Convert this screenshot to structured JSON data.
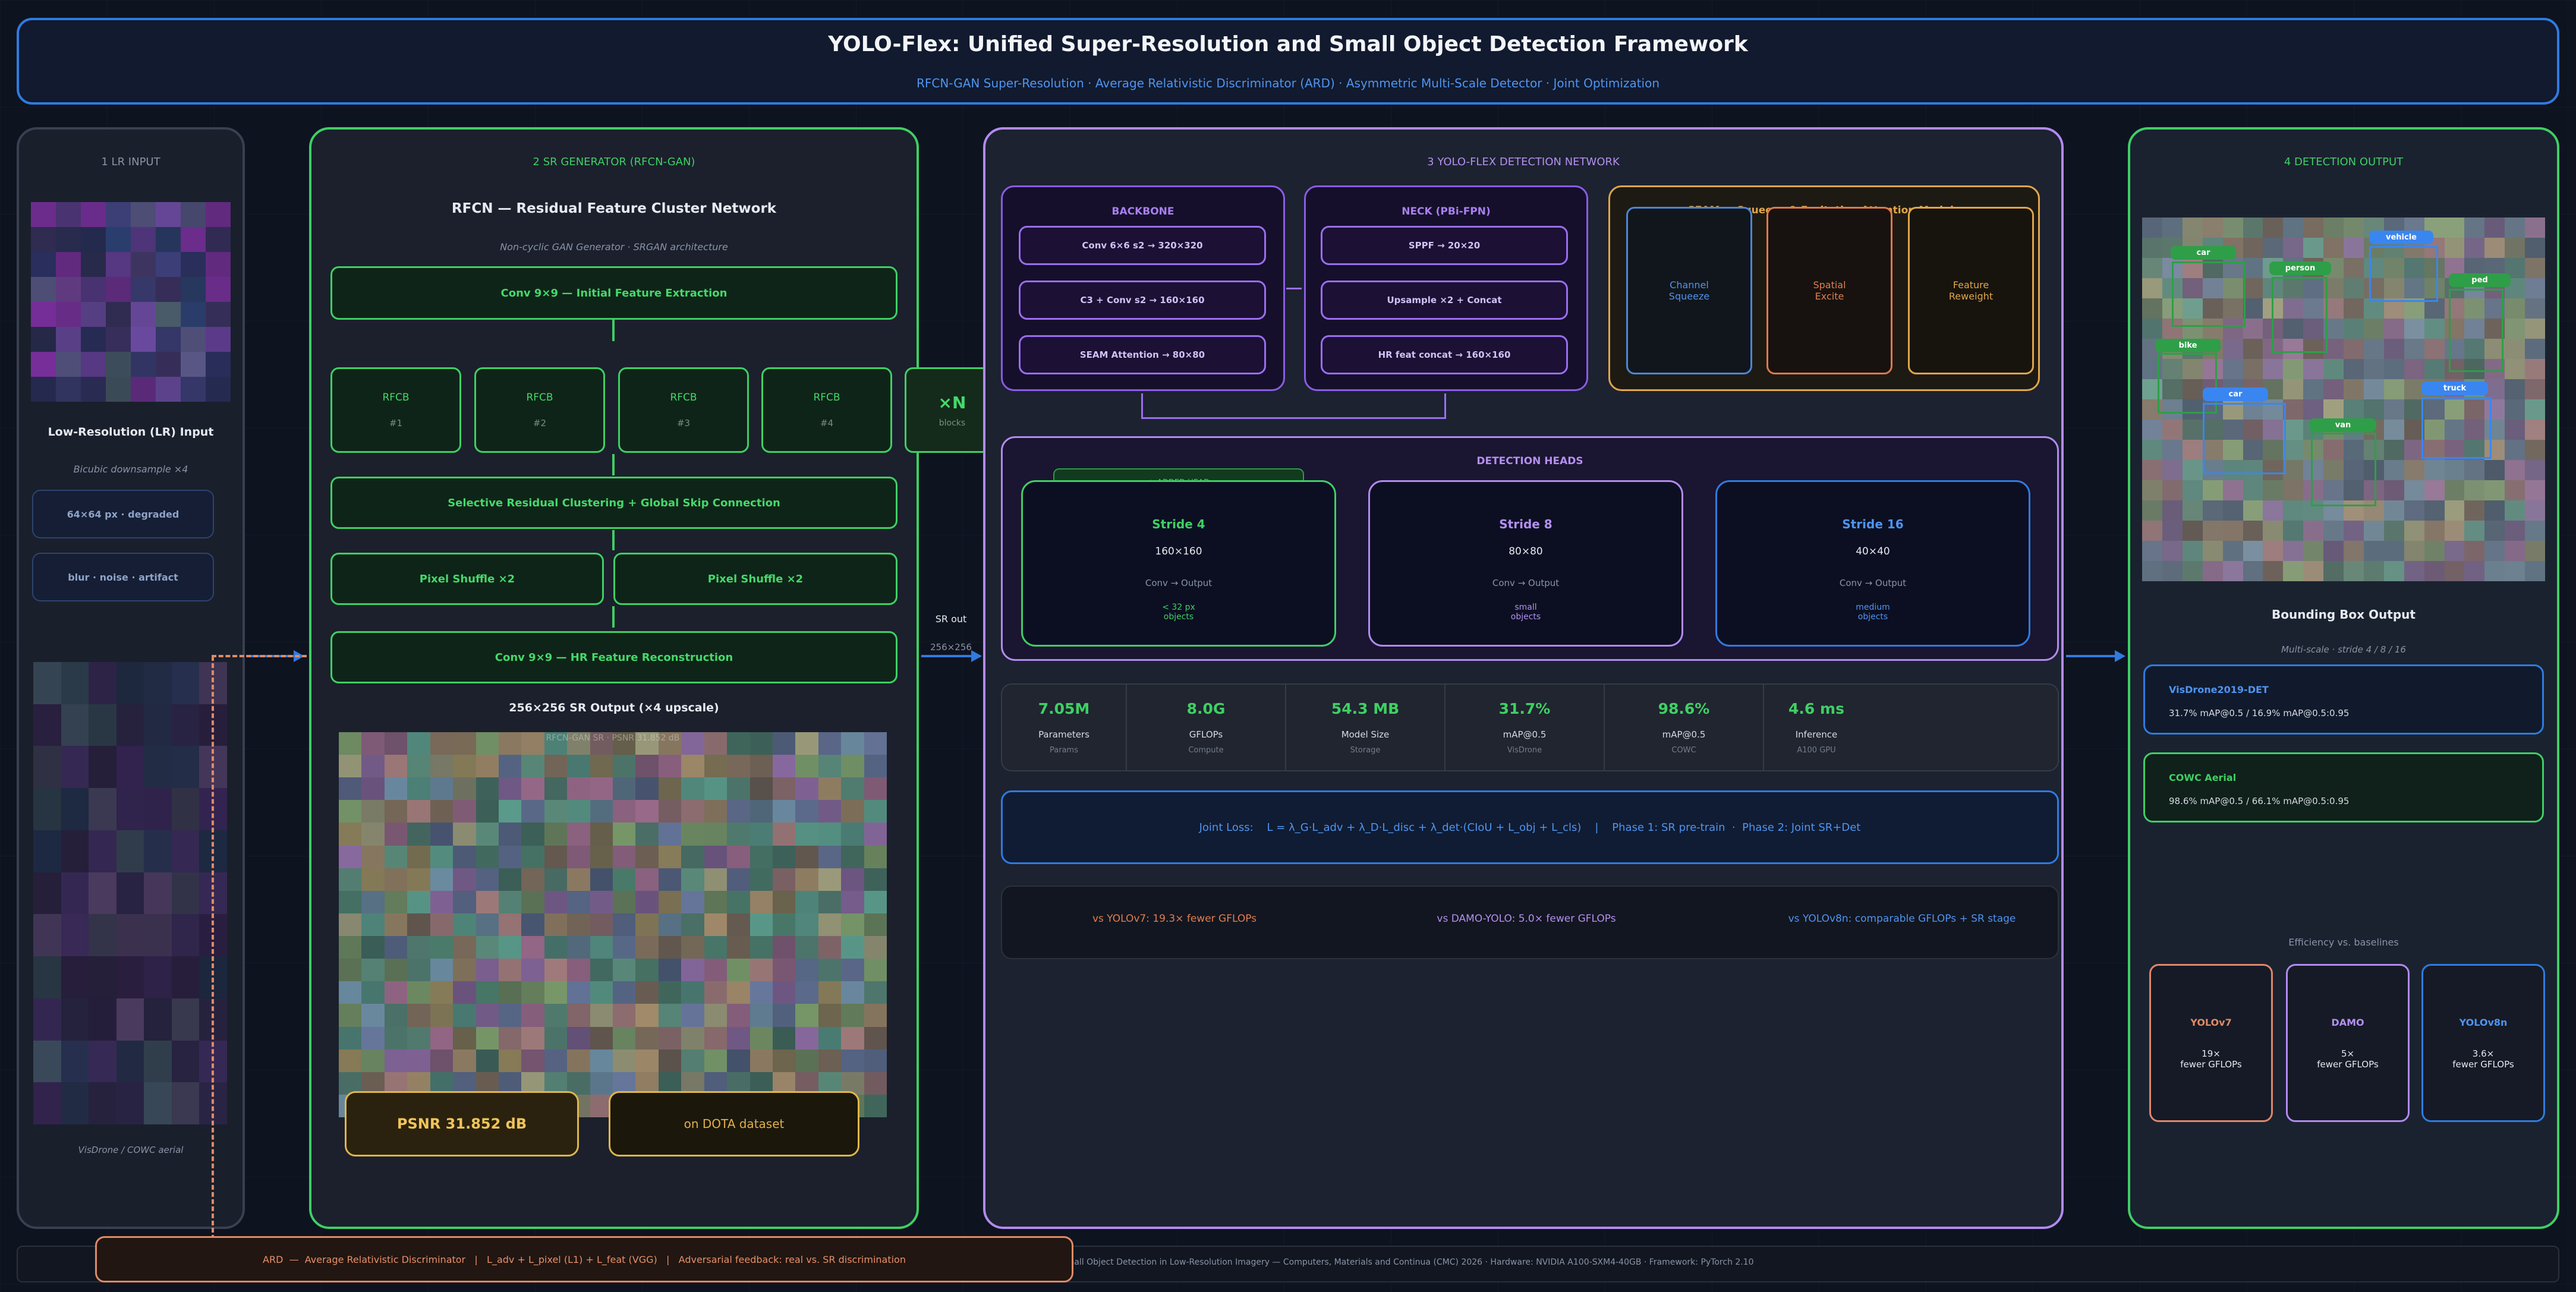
{
  "title": "YOLO-Flex: Unified Super-Resolution and Small Object Detection Framework",
  "subtitle": "RFCN-GAN Super-Resolution   ·   Average Relativistic Discriminator (ARD)   ·   Asymmetric Multi-Scale Detector   ·   Joint Optimization",
  "colors": {
    "green": "#3fcf64",
    "purple": "#9a6ef0",
    "blue": "#2f7be0",
    "orange": "#e0a64a",
    "salmon": "#e08a66"
  },
  "lr_input": {
    "header": "1  LR INPUT",
    "title": "Low-Resolution (LR) Input",
    "subtitle": "Bicubic downsample  ×4",
    "chip1": "64×64 px  ·  degraded",
    "chip2": "blur · noise · artifact",
    "caption": "VisDrone / COWC aerial"
  },
  "sr_generator": {
    "header": "2  SR GENERATOR (RFCN-GAN)",
    "title": "RFCN — Residual Feature Cluster Network",
    "subtitle": "Non-cyclic GAN Generator  ·  SRGAN architecture",
    "conv_in": "Conv 9×9  —  Initial Feature Extraction",
    "rfcb": [
      {
        "label": "RFCB",
        "num": "#1"
      },
      {
        "label": "RFCB",
        "num": "#2"
      },
      {
        "label": "RFCB",
        "num": "#3"
      },
      {
        "label": "RFCB",
        "num": "#4"
      }
    ],
    "repeat": "×N",
    "repeat_sub": "blocks",
    "clustering": "Selective Residual Clustering  +  Global Skip Connection",
    "pixel_shuffle_1": "Pixel Shuffle  ×2",
    "pixel_shuffle_2": "Pixel Shuffle  ×2",
    "conv_out": "Conv 9×9  —  HR Feature Reconstruction",
    "sr_output": "256×256 SR Output  (×4 upscale)",
    "sr_watermark": "RFCN-GAN SR  ·  PSNR 31.852 dB",
    "psnr": "PSNR  31.852 dB",
    "dataset": "on DOTA dataset",
    "sr_out_label": "SR out",
    "sr_out_size": "256×256"
  },
  "detection": {
    "header": "3  YOLO-FLEX DETECTION NETWORK",
    "backbone": {
      "title": "BACKBONE",
      "items": [
        "Conv 6×6 s2  →  320×320",
        "C3 + Conv s2  →  160×160",
        "SEAM Attention → 80×80"
      ]
    },
    "neck": {
      "title": "NECK  (PBi-FPN)",
      "items": [
        "SPPF  →  20×20",
        "Upsample ×2  +  Concat",
        "HR feat concat  →  160×160"
      ]
    },
    "seam": {
      "title": "SEAM  —  Squeeze & Excitation Attention Module",
      "steps": [
        {
          "line1": "Channel",
          "line2": "Squeeze"
        },
        {
          "line1": "Spatial",
          "line2": "Excite"
        },
        {
          "line1": "Feature",
          "line2": "Reweight"
        }
      ]
    },
    "heads": {
      "title": "DETECTION HEADS",
      "added": "★  ADDED HEAD",
      "items": [
        {
          "name": "Stride 4",
          "size": "160×160",
          "op": "Conv → Output",
          "target1": "< 32 px",
          "target2": "objects"
        },
        {
          "name": "Stride 8",
          "size": "80×80",
          "op": "Conv → Output",
          "target1": "small",
          "target2": "objects"
        },
        {
          "name": "Stride 16",
          "size": "40×40",
          "op": "Conv → Output",
          "target1": "medium",
          "target2": "objects"
        }
      ]
    },
    "metrics": [
      {
        "value": "7.05M",
        "label": "Parameters",
        "sub": "Params"
      },
      {
        "value": "8.0G",
        "label": "GFLOPs",
        "sub": "Compute"
      },
      {
        "value": "54.3 MB",
        "label": "Model Size",
        "sub": "Storage"
      },
      {
        "value": "31.7%",
        "label": "mAP@0.5",
        "sub": "VisDrone"
      },
      {
        "value": "98.6%",
        "label": "mAP@0.5",
        "sub": "COWC"
      },
      {
        "value": "4.6 ms",
        "label": "Inference",
        "sub": "A100 GPU"
      }
    ],
    "joint_loss": "Joint Loss:    L = λ_G·L_adv + λ_D·L_disc + λ_det·(CIoU + L_obj + L_cls)    |    Phase 1: SR pre-train  ·  Phase 2: Joint SR+Det",
    "comparisons": [
      "vs YOLOv7:  19.3× fewer GFLOPs",
      "vs DAMO-YOLO:  5.0× fewer GFLOPs",
      "vs YOLOv8n:  comparable GFLOPs  +  SR stage"
    ]
  },
  "output": {
    "header": "4  DETECTION OUTPUT",
    "tags": [
      "car",
      "person",
      "vehicle",
      "ped",
      "bike",
      "car",
      "truck",
      "van"
    ],
    "title": "Bounding Box Output",
    "subtitle": "Multi-scale  ·  stride 4 / 8 / 16",
    "res1_title": "VisDrone2019-DET",
    "res1_value": "31.7%  mAP@0.5  /  16.9%  mAP@0.5:0.95",
    "res2_title": "COWC Aerial",
    "res2_value": "98.6%  mAP@0.5  /  66.1%  mAP@0.5:0.95",
    "efficiency": "Efficiency vs. baselines",
    "baselines": [
      {
        "name": "YOLOv7",
        "factor": "19×",
        "desc": "fewer GFLOPs"
      },
      {
        "name": "DAMO",
        "factor": "5×",
        "desc": "fewer GFLOPs"
      },
      {
        "name": "YOLOv8n",
        "factor": "3.6×",
        "desc": "fewer GFLOPs"
      }
    ]
  },
  "ard": "ARD  —  Average Relativistic Discriminator   |   L_adv + L_pixel (L1) + L_feat (VGG)   |   Adversarial feedback: real vs. SR discrimination",
  "footer": "Ibrahim A. et al. — YOLO-Flex: Optimizing Small Object Detection in Low-Resolution Imagery  —  Computers, Materials and Continua (CMC) 2026  ·  Hardware: NVIDIA A100-SXM4-40GB  ·  Framework: PyTorch 2.10"
}
